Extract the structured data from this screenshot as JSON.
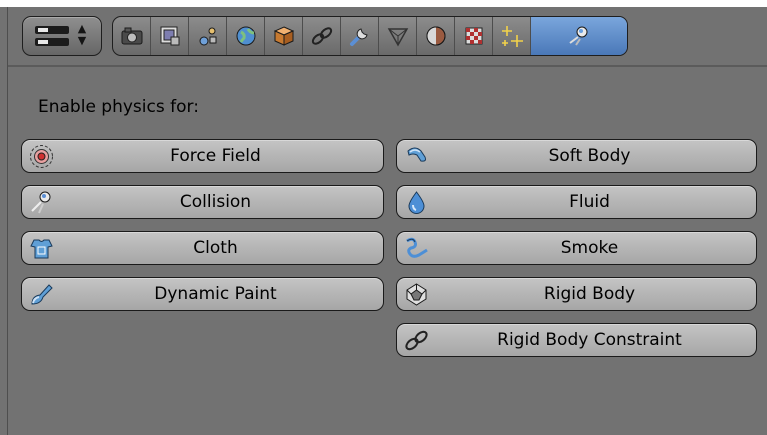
{
  "header": {
    "editor_type": "properties-editor",
    "context_tabs": [
      {
        "id": "render",
        "icon": "camera-icon",
        "active": false
      },
      {
        "id": "render-layers",
        "icon": "render-layers-icon",
        "active": false
      },
      {
        "id": "scene",
        "icon": "scene-icon",
        "active": false
      },
      {
        "id": "world",
        "icon": "world-icon",
        "active": false
      },
      {
        "id": "object",
        "icon": "object-cube-icon",
        "active": false
      },
      {
        "id": "constraints",
        "icon": "link-icon",
        "active": false
      },
      {
        "id": "modifiers",
        "icon": "wrench-icon",
        "active": false
      },
      {
        "id": "data",
        "icon": "mesh-data-icon",
        "active": false
      },
      {
        "id": "material",
        "icon": "material-sphere-icon",
        "active": false
      },
      {
        "id": "texture",
        "icon": "texture-checker-icon",
        "active": false
      },
      {
        "id": "particles",
        "icon": "particles-icon",
        "active": false
      },
      {
        "id": "physics",
        "icon": "physics-icon",
        "active": true
      }
    ]
  },
  "physics": {
    "section_label": "Enable physics for:",
    "left_buttons": [
      {
        "label": "Force Field",
        "icon": "force-field-icon"
      },
      {
        "label": "Collision",
        "icon": "collision-icon"
      },
      {
        "label": "Cloth",
        "icon": "cloth-icon"
      },
      {
        "label": "Dynamic Paint",
        "icon": "dynamic-paint-icon"
      }
    ],
    "right_buttons": [
      {
        "label": "Soft Body",
        "icon": "soft-body-icon"
      },
      {
        "label": "Fluid",
        "icon": "fluid-icon"
      },
      {
        "label": "Smoke",
        "icon": "smoke-icon"
      },
      {
        "label": "Rigid Body",
        "icon": "rigid-body-icon"
      },
      {
        "label": "Rigid Body Constraint",
        "icon": "rigid-body-constraint-icon"
      }
    ]
  },
  "colors": {
    "background": "#727272",
    "button": "#b4b4b4",
    "active_tab": "#5a88c8"
  }
}
